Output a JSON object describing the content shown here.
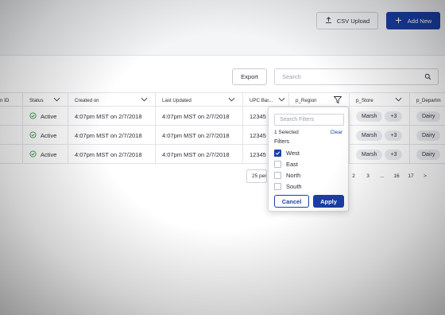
{
  "header": {
    "csv_upload_label": "CSV Upload",
    "add_new_label": "Add New"
  },
  "toolbar": {
    "export_label": "Export",
    "search_placeholder": "Search"
  },
  "table": {
    "columns": [
      "n ID",
      "Status",
      "Created on",
      "Last Updated",
      "UPC Bar...",
      "p_Region",
      "p_Store",
      "p_Departm"
    ],
    "rows": [
      {
        "id": "",
        "status": "Active",
        "created": "4:07pm MST on 2/7/2018",
        "updated": "4:07pm MST on 2/7/2018",
        "upc": "12345",
        "store": "Marsh",
        "more": "+3",
        "dept": "Dairy"
      },
      {
        "id": "",
        "status": "Active",
        "created": "4:07pm MST on 2/7/2018",
        "updated": "4:07pm MST on 2/7/2018",
        "upc": "12345",
        "store": "Marsh",
        "more": "+3",
        "dept": "Dairy"
      },
      {
        "id": "",
        "status": "Active",
        "created": "4:07pm MST on 2/7/2018",
        "updated": "4:07pm MST on 2/7/2018",
        "upc": "12345",
        "store": "Marsh",
        "more": "+3",
        "dept": "Dairy"
      }
    ]
  },
  "pagination": {
    "per_page": "25 per page",
    "pages": [
      "2",
      "3",
      "...",
      "16",
      "17"
    ],
    "next": ">"
  },
  "filter_dropdown": {
    "search_placeholder": "Search Filters",
    "selected_count": "1 Selected",
    "clear_label": "Clear",
    "filters_heading": "Filters",
    "options": [
      {
        "label": "West",
        "checked": true
      },
      {
        "label": "East",
        "checked": false
      },
      {
        "label": "North",
        "checked": false
      },
      {
        "label": "South",
        "checked": false
      }
    ],
    "cancel_label": "Cancel",
    "apply_label": "Apply"
  },
  "colors": {
    "primary": "#1a3fa6",
    "active_status": "#3a9a4a"
  }
}
